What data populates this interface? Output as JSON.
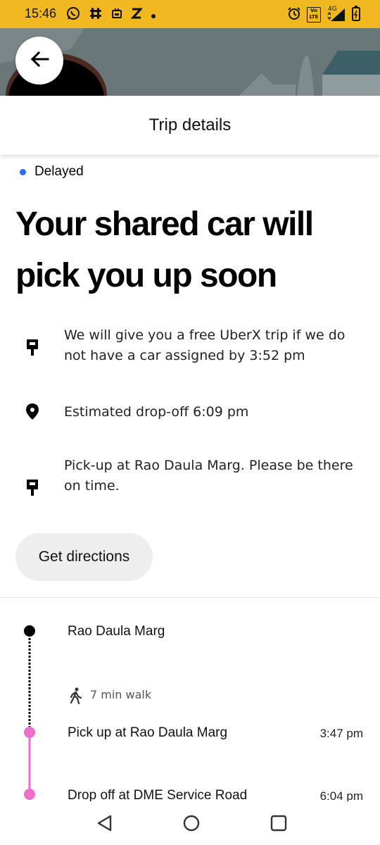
{
  "status_bar": {
    "time": "15:46",
    "left_icons": [
      "whatsapp-icon",
      "slack-icon",
      "calendar-icon",
      "zomato-icon",
      "dot-icon"
    ],
    "right_icons": [
      "alarm-icon",
      "volte-icon",
      "signal-icon",
      "battery-icon"
    ],
    "network_label": "4G",
    "volte_label": "Vo LTE",
    "background": "#f1b91f"
  },
  "map": {
    "background": "#6a7778"
  },
  "header": {
    "back_icon": "back-arrow-icon",
    "title": "Trip details"
  },
  "trip_status": {
    "label": "Delayed",
    "dot_color": "#276ef1"
  },
  "headline": {
    "line1": "Your shared car will",
    "line2": "pick you up soon"
  },
  "info_items": [
    {
      "icon": "pickup-sign-icon",
      "text": "We will give you a free UberX trip if we do not have a car assigned by 3:52 pm"
    },
    {
      "icon": "location-pin-icon",
      "text": "Estimated drop-off 6:09 pm"
    },
    {
      "icon": "pickup-sign-icon",
      "text": "Pick-up at Rao Daula Marg. Please be there on time."
    }
  ],
  "directions_button": {
    "label": "Get directions"
  },
  "timeline": {
    "start": {
      "label": "Rao Daula Marg"
    },
    "walk": {
      "icon": "walking-person-icon",
      "label": "7 min walk"
    },
    "pickup": {
      "label": "Pick up at Rao Daula Marg",
      "time": "3:47 pm"
    },
    "dropoff": {
      "label": "Drop off at DME Service Road",
      "time": "6:04 pm"
    },
    "ride_color": "#f06ecb"
  },
  "nav_bar": {
    "back_icon": "nav-back-icon",
    "home_icon": "nav-home-icon",
    "recents_icon": "nav-recents-icon"
  }
}
